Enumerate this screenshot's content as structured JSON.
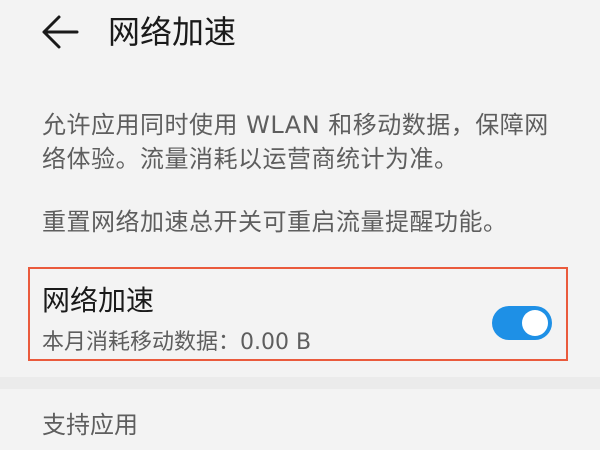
{
  "header": {
    "back_icon": "arrow-left-icon",
    "title": "网络加速"
  },
  "description": {
    "line1": "允许应用同时使用 WLAN 和移动数据，保障网络体验。流量消耗以运营商统计为准。",
    "line2": "重置网络加速总开关可重启流量提醒功能。"
  },
  "setting": {
    "title": "网络加速",
    "usage": "本月消耗移动数据：0.00 B",
    "toggle_on": true,
    "toggle_color": "#1e90e6",
    "highlight_color": "#ea5a3c"
  },
  "section": {
    "title": "支持应用"
  }
}
